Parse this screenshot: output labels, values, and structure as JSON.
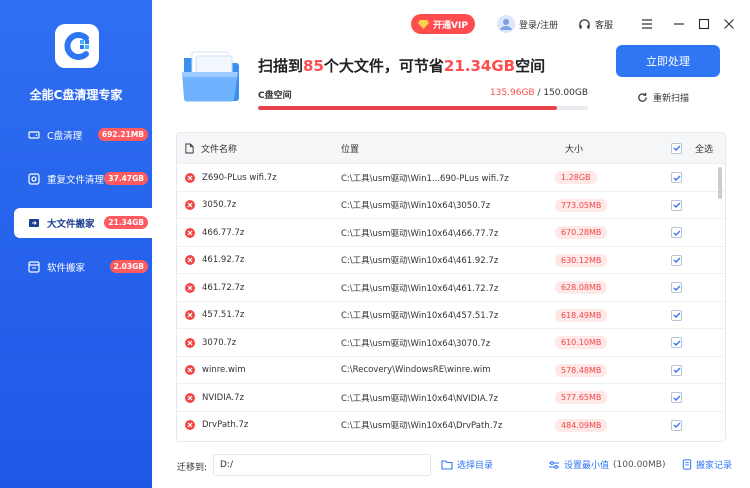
{
  "app": {
    "title": "全能C盘清理专家"
  },
  "sidebar": {
    "items": [
      {
        "label": "C盘清理",
        "badge": "692.21MB",
        "icon": "disk-icon",
        "active": false
      },
      {
        "label": "重复文件清理",
        "badge": "37.47GB",
        "icon": "duplicate-icon",
        "active": false
      },
      {
        "label": "大文件搬家",
        "badge": "21.34GB",
        "icon": "move-file-icon",
        "active": true
      },
      {
        "label": "软件搬家",
        "badge": "2.03GB",
        "icon": "software-move-icon",
        "active": false
      }
    ]
  },
  "topbar": {
    "vip_label": "开通VIP",
    "login_label": "登录/注册",
    "service_label": "客服"
  },
  "scan": {
    "title_prefix": "扫描到",
    "file_count": "85",
    "title_middle": "个大文件，可节省",
    "save_size": "21.34GB",
    "title_suffix": "空间",
    "disk_label": "C盘空间",
    "disk_used": "135.96GB",
    "disk_separator": " / ",
    "disk_total": "150.00GB",
    "disk_used_fraction": 0.906,
    "process_label": "立即处理",
    "rescan_label": "重新扫描"
  },
  "table": {
    "headers": {
      "name": "文件名称",
      "location": "位置",
      "size": "大小",
      "select_all": "全选"
    },
    "rows": [
      {
        "name": "Z690-PLus wifi.7z",
        "location": "C:\\工具\\usm驱动\\Win1...690-PLus wifi.7z",
        "size": "1.28GB"
      },
      {
        "name": "3050.7z",
        "location": "C:\\工具\\usm驱动\\Win10x64\\3050.7z",
        "size": "773.05MB"
      },
      {
        "name": "466.77.7z",
        "location": "C:\\工具\\usm驱动\\Win10x64\\466.77.7z",
        "size": "670.28MB"
      },
      {
        "name": "461.92.7z",
        "location": "C:\\工具\\usm驱动\\Win10x64\\461.92.7z",
        "size": "630.12MB"
      },
      {
        "name": "461.72.7z",
        "location": "C:\\工具\\usm驱动\\Win10x64\\461.72.7z",
        "size": "628.08MB"
      },
      {
        "name": "457.51.7z",
        "location": "C:\\工具\\usm驱动\\Win10x64\\457.51.7z",
        "size": "618.49MB"
      },
      {
        "name": "3070.7z",
        "location": "C:\\工具\\usm驱动\\Win10x64\\3070.7z",
        "size": "610.10MB"
      },
      {
        "name": "winre.wim",
        "location": "C:\\Recovery\\WindowsRE\\winre.wim",
        "size": "578.48MB"
      },
      {
        "name": "NVIDIA.7z",
        "location": "C:\\工具\\usm驱动\\Win10x64\\NVIDIA.7z",
        "size": "577.65MB"
      },
      {
        "name": "DrvPath.7z",
        "location": "C:\\工具\\usm驱动\\Win10x64\\DrvPath.7z",
        "size": "484.09MB"
      }
    ]
  },
  "footer": {
    "move_to_label": "迁移到:",
    "path_value": "D:/",
    "choose_dir_label": "选择目录",
    "set_min_label": "设置最小值",
    "min_value": "(100.00MB)",
    "move_log_label": "搬家记录"
  },
  "colors": {
    "accent": "#2f76f5",
    "sidebar": "#2563eb",
    "danger": "#f04848"
  }
}
